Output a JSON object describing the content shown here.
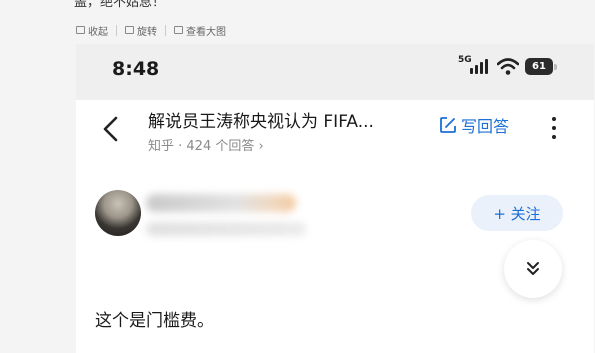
{
  "article": {
    "cut_text": "盖，绝不姑息！"
  },
  "toolbar": {
    "collapse": "收起",
    "rotate": "旋转",
    "view_large": "查看大图"
  },
  "status_bar": {
    "time": "8:48",
    "network": "5G",
    "battery": "61"
  },
  "question": {
    "title": "解说员王涛称央视认为 FIFA...",
    "meta": "知乎 · 424 个回答 ›",
    "write_answer": "写回答",
    "accent_color": "#1c6fd6"
  },
  "author": {
    "follow_label": "+ 关注"
  },
  "answer": {
    "text": "这个是门槛费。"
  },
  "icons": [
    "back-arrow-icon",
    "edit-icon",
    "more-icon",
    "chevron-double-down-icon",
    "wifi-icon",
    "signal-icon"
  ]
}
